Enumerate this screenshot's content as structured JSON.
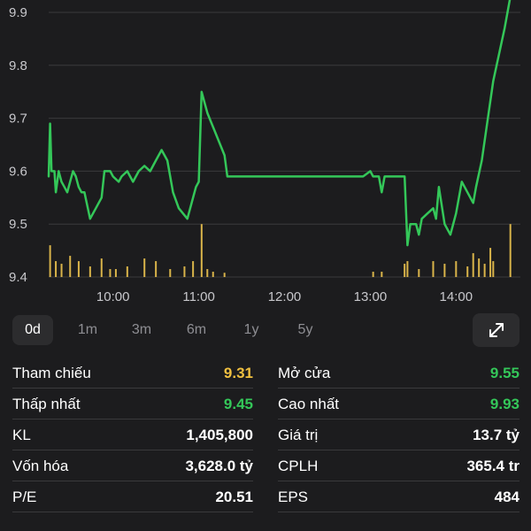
{
  "chart_data": {
    "type": "line",
    "y_ticks": [
      "9.9",
      "9.8",
      "9.7",
      "9.6",
      "9.5",
      "9.4"
    ],
    "x_ticks": [
      "10:00",
      "11:00",
      "12:00",
      "13:00",
      "14:00"
    ],
    "ylim": [
      9.4,
      9.9
    ],
    "xlim": [
      "09:15",
      "14:45"
    ],
    "line_color": "#34c759",
    "volume_color": "#d9b44a",
    "grid_color": "#3a3a3c",
    "price": [
      [
        "09:15",
        9.59
      ],
      [
        "09:16",
        9.69
      ],
      [
        "09:17",
        9.6
      ],
      [
        "09:19",
        9.6
      ],
      [
        "09:20",
        9.56
      ],
      [
        "09:22",
        9.6
      ],
      [
        "09:24",
        9.58
      ],
      [
        "09:26",
        9.57
      ],
      [
        "09:28",
        9.56
      ],
      [
        "09:30",
        9.58
      ],
      [
        "09:32",
        9.6
      ],
      [
        "09:34",
        9.59
      ],
      [
        "09:36",
        9.57
      ],
      [
        "09:38",
        9.56
      ],
      [
        "09:40",
        9.56
      ],
      [
        "09:44",
        9.51
      ],
      [
        "09:48",
        9.53
      ],
      [
        "09:52",
        9.55
      ],
      [
        "09:54",
        9.6
      ],
      [
        "09:58",
        9.6
      ],
      [
        "10:00",
        9.59
      ],
      [
        "10:04",
        9.58
      ],
      [
        "10:06",
        9.59
      ],
      [
        "10:10",
        9.6
      ],
      [
        "10:14",
        9.58
      ],
      [
        "10:18",
        9.6
      ],
      [
        "10:22",
        9.61
      ],
      [
        "10:26",
        9.6
      ],
      [
        "10:30",
        9.62
      ],
      [
        "10:34",
        9.64
      ],
      [
        "10:38",
        9.62
      ],
      [
        "10:42",
        9.56
      ],
      [
        "10:46",
        9.53
      ],
      [
        "10:52",
        9.51
      ],
      [
        "10:58",
        9.57
      ],
      [
        "11:00",
        9.58
      ],
      [
        "11:02",
        9.75
      ],
      [
        "11:06",
        9.71
      ],
      [
        "11:12",
        9.67
      ],
      [
        "11:18",
        9.63
      ],
      [
        "11:20",
        9.59
      ],
      [
        "11:30",
        9.59
      ],
      [
        "12:00",
        9.59
      ],
      [
        "12:30",
        9.59
      ],
      [
        "12:55",
        9.59
      ],
      [
        "13:00",
        9.6
      ],
      [
        "13:02",
        9.59
      ],
      [
        "13:06",
        9.59
      ],
      [
        "13:08",
        9.56
      ],
      [
        "13:10",
        9.59
      ],
      [
        "13:20",
        9.59
      ],
      [
        "13:24",
        9.59
      ],
      [
        "13:26",
        9.46
      ],
      [
        "13:28",
        9.5
      ],
      [
        "13:32",
        9.5
      ],
      [
        "13:34",
        9.48
      ],
      [
        "13:36",
        9.51
      ],
      [
        "13:40",
        9.52
      ],
      [
        "13:44",
        9.53
      ],
      [
        "13:46",
        9.51
      ],
      [
        "13:48",
        9.57
      ],
      [
        "13:52",
        9.5
      ],
      [
        "13:56",
        9.48
      ],
      [
        "14:00",
        9.52
      ],
      [
        "14:04",
        9.58
      ],
      [
        "14:08",
        9.56
      ],
      [
        "14:12",
        9.54
      ],
      [
        "14:14",
        9.57
      ],
      [
        "14:18",
        9.62
      ],
      [
        "14:26",
        9.77
      ],
      [
        "14:34",
        9.87
      ],
      [
        "14:38",
        9.93
      ]
    ],
    "volume": [
      [
        "09:16",
        0.6
      ],
      [
        "09:20",
        0.3
      ],
      [
        "09:24",
        0.25
      ],
      [
        "09:30",
        0.4
      ],
      [
        "09:36",
        0.3
      ],
      [
        "09:44",
        0.2
      ],
      [
        "09:52",
        0.35
      ],
      [
        "09:58",
        0.15
      ],
      [
        "10:02",
        0.15
      ],
      [
        "10:10",
        0.2
      ],
      [
        "10:22",
        0.35
      ],
      [
        "10:30",
        0.3
      ],
      [
        "10:40",
        0.15
      ],
      [
        "10:50",
        0.2
      ],
      [
        "10:56",
        0.3
      ],
      [
        "11:02",
        1.0
      ],
      [
        "11:06",
        0.15
      ],
      [
        "11:10",
        0.1
      ],
      [
        "11:18",
        0.08
      ],
      [
        "13:02",
        0.1
      ],
      [
        "13:08",
        0.1
      ],
      [
        "13:24",
        0.25
      ],
      [
        "13:26",
        0.3
      ],
      [
        "13:34",
        0.15
      ],
      [
        "13:44",
        0.3
      ],
      [
        "13:52",
        0.25
      ],
      [
        "14:00",
        0.3
      ],
      [
        "14:08",
        0.2
      ],
      [
        "14:12",
        0.45
      ],
      [
        "14:16",
        0.35
      ],
      [
        "14:20",
        0.25
      ],
      [
        "14:24",
        0.55
      ],
      [
        "14:26",
        0.3
      ],
      [
        "14:38",
        1.0
      ]
    ]
  },
  "range_tabs": [
    "0d",
    "1m",
    "3m",
    "6m",
    "1y",
    "5y"
  ],
  "active_range": "0d",
  "stats": {
    "left": [
      {
        "label": "Tham chiếu",
        "value": "9.31",
        "color": "yellow"
      },
      {
        "label": "Thấp nhất",
        "value": "9.45",
        "color": "green"
      },
      {
        "label": "KL",
        "value": "1,405,800",
        "color": "white"
      },
      {
        "label": "Vốn hóa",
        "value": "3,628.0 tỷ",
        "color": "white"
      },
      {
        "label": "P/E",
        "value": "20.51",
        "color": "white"
      }
    ],
    "right": [
      {
        "label": "Mở cửa",
        "value": "9.55",
        "color": "green"
      },
      {
        "label": "Cao nhất",
        "value": "9.93",
        "color": "green"
      },
      {
        "label": "Giá trị",
        "value": "13.7 tỷ",
        "color": "white"
      },
      {
        "label": "CPLH",
        "value": "365.4 tr",
        "color": "white"
      },
      {
        "label": "EPS",
        "value": "484",
        "color": "white"
      }
    ]
  },
  "icons": {
    "expand": "expand-arrows-icon"
  }
}
